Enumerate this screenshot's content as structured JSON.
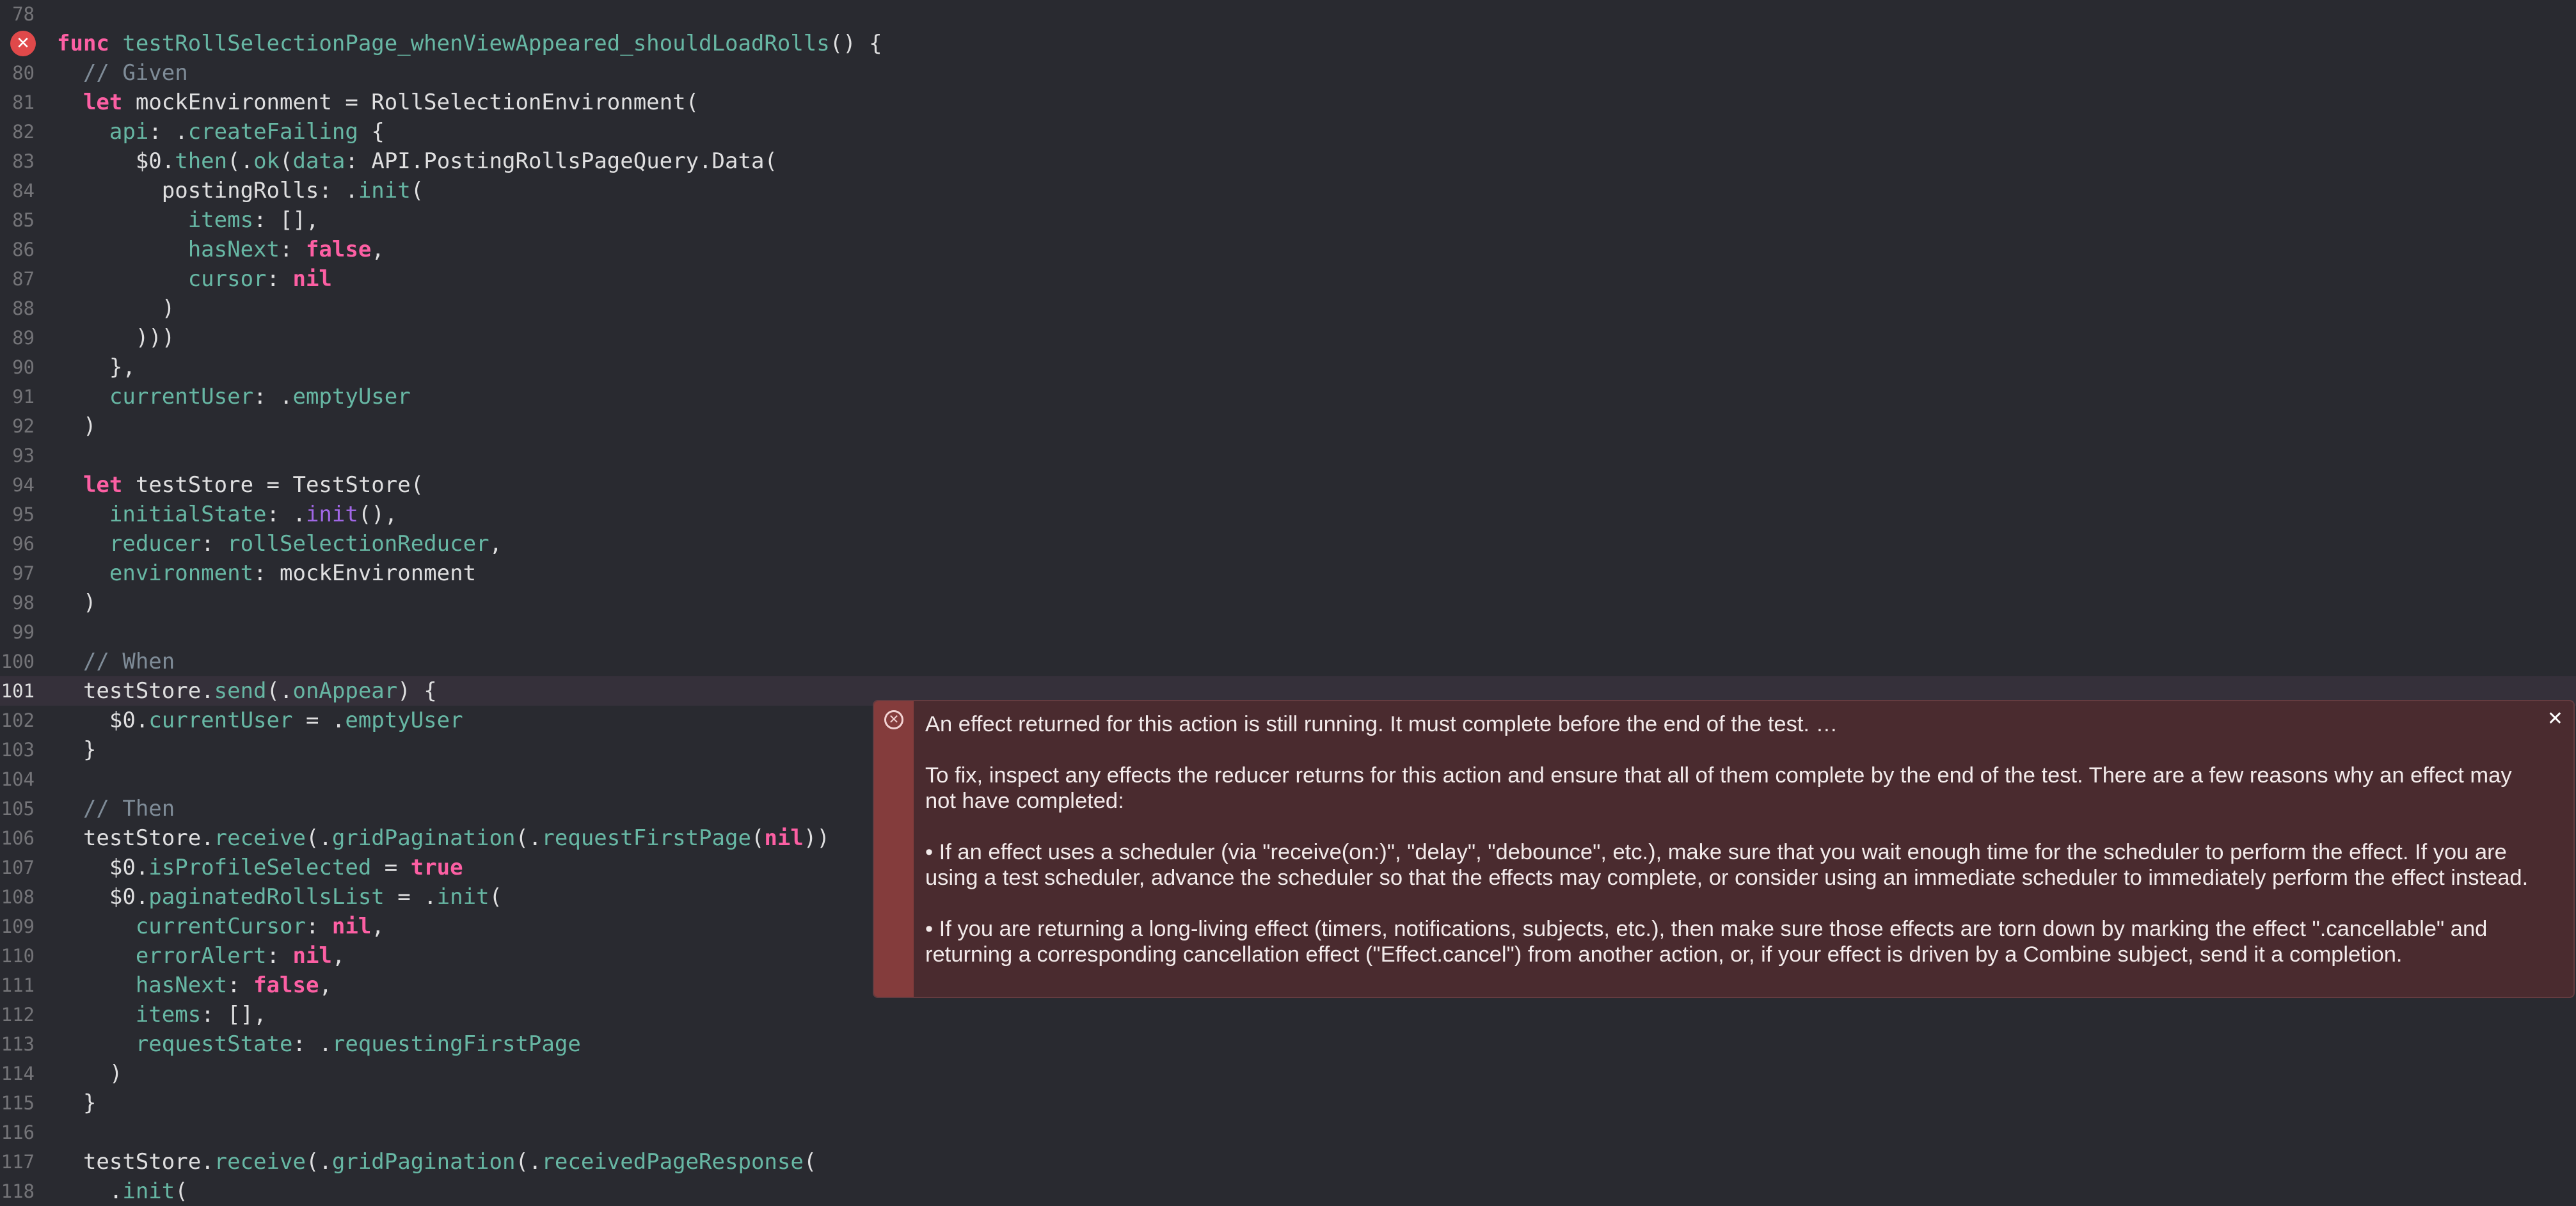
{
  "editor": {
    "lines": [
      {
        "n": "78",
        "spans": []
      },
      {
        "n": "",
        "spans": [
          {
            "t": "func",
            "c": "kw"
          },
          {
            "t": " "
          },
          {
            "t": "testRollSelectionPage_whenViewAppeared_shouldLoadRolls",
            "c": "fn"
          },
          {
            "t": "() {"
          }
        ]
      },
      {
        "n": "80",
        "spans": [
          {
            "t": "  // Given",
            "c": "cm"
          }
        ]
      },
      {
        "n": "81",
        "spans": [
          {
            "t": "  "
          },
          {
            "t": "let",
            "c": "kw"
          },
          {
            "t": " mockEnvironment = RollSelectionEnvironment("
          }
        ]
      },
      {
        "n": "82",
        "spans": [
          {
            "t": "    "
          },
          {
            "t": "api",
            "c": "fn"
          },
          {
            "t": ": ."
          },
          {
            "t": "createFailing",
            "c": "fn"
          },
          {
            "t": " {"
          }
        ]
      },
      {
        "n": "83",
        "spans": [
          {
            "t": "      $0."
          },
          {
            "t": "then",
            "c": "fn"
          },
          {
            "t": "(."
          },
          {
            "t": "ok",
            "c": "fn"
          },
          {
            "t": "("
          },
          {
            "t": "data",
            "c": "fn"
          },
          {
            "t": ": API.PostingRollsPageQuery.Data("
          }
        ]
      },
      {
        "n": "84",
        "spans": [
          {
            "t": "        postingRolls: ."
          },
          {
            "t": "init",
            "c": "fn"
          },
          {
            "t": "("
          }
        ]
      },
      {
        "n": "85",
        "spans": [
          {
            "t": "          "
          },
          {
            "t": "items",
            "c": "fn"
          },
          {
            "t": ": [],"
          }
        ]
      },
      {
        "n": "86",
        "spans": [
          {
            "t": "          "
          },
          {
            "t": "hasNext",
            "c": "fn"
          },
          {
            "t": ": "
          },
          {
            "t": "false",
            "c": "kw"
          },
          {
            "t": ","
          }
        ]
      },
      {
        "n": "87",
        "spans": [
          {
            "t": "          "
          },
          {
            "t": "cursor",
            "c": "fn"
          },
          {
            "t": ": "
          },
          {
            "t": "nil",
            "c": "kw"
          }
        ]
      },
      {
        "n": "88",
        "spans": [
          {
            "t": "        )"
          }
        ]
      },
      {
        "n": "89",
        "spans": [
          {
            "t": "      )))"
          }
        ]
      },
      {
        "n": "90",
        "spans": [
          {
            "t": "    },"
          }
        ]
      },
      {
        "n": "91",
        "spans": [
          {
            "t": "    "
          },
          {
            "t": "currentUser",
            "c": "fn"
          },
          {
            "t": ": ."
          },
          {
            "t": "emptyUser",
            "c": "fn"
          }
        ]
      },
      {
        "n": "92",
        "spans": [
          {
            "t": "  )"
          }
        ]
      },
      {
        "n": "93",
        "spans": []
      },
      {
        "n": "94",
        "spans": [
          {
            "t": "  "
          },
          {
            "t": "let",
            "c": "kw"
          },
          {
            "t": " testStore = TestStore("
          }
        ]
      },
      {
        "n": "95",
        "spans": [
          {
            "t": "    "
          },
          {
            "t": "initialState",
            "c": "fn"
          },
          {
            "t": ": ."
          },
          {
            "t": "init",
            "c": "mem"
          },
          {
            "t": "(),"
          }
        ]
      },
      {
        "n": "96",
        "spans": [
          {
            "t": "    "
          },
          {
            "t": "reducer",
            "c": "fn"
          },
          {
            "t": ": "
          },
          {
            "t": "rollSelectionReducer",
            "c": "fn"
          },
          {
            "t": ","
          }
        ]
      },
      {
        "n": "97",
        "spans": [
          {
            "t": "    "
          },
          {
            "t": "environment",
            "c": "fn"
          },
          {
            "t": ": mockEnvironment"
          }
        ]
      },
      {
        "n": "98",
        "spans": [
          {
            "t": "  )"
          }
        ]
      },
      {
        "n": "99",
        "spans": []
      },
      {
        "n": "100",
        "spans": [
          {
            "t": "  // When",
            "c": "cm"
          }
        ]
      },
      {
        "n": "101",
        "spans": [
          {
            "t": "  testStore."
          },
          {
            "t": "send",
            "c": "fn"
          },
          {
            "t": "(."
          },
          {
            "t": "onAppear",
            "c": "fn"
          },
          {
            "t": ") {"
          }
        ]
      },
      {
        "n": "102",
        "spans": [
          {
            "t": "    $0."
          },
          {
            "t": "currentUser",
            "c": "fn"
          },
          {
            "t": " = ."
          },
          {
            "t": "emptyUser",
            "c": "fn"
          }
        ]
      },
      {
        "n": "103",
        "spans": [
          {
            "t": "  }"
          }
        ]
      },
      {
        "n": "104",
        "spans": []
      },
      {
        "n": "105",
        "spans": [
          {
            "t": "  // Then",
            "c": "cm"
          }
        ]
      },
      {
        "n": "106",
        "spans": [
          {
            "t": "  testStore."
          },
          {
            "t": "receive",
            "c": "fn"
          },
          {
            "t": "(."
          },
          {
            "t": "gridPagination",
            "c": "fn"
          },
          {
            "t": "(."
          },
          {
            "t": "requestFirstPage",
            "c": "fn"
          },
          {
            "t": "("
          },
          {
            "t": "nil",
            "c": "kw"
          },
          {
            "t": "))"
          }
        ]
      },
      {
        "n": "107",
        "spans": [
          {
            "t": "    $0."
          },
          {
            "t": "isProfileSelected",
            "c": "fn"
          },
          {
            "t": " = "
          },
          {
            "t": "true",
            "c": "kw"
          }
        ]
      },
      {
        "n": "108",
        "spans": [
          {
            "t": "    $0."
          },
          {
            "t": "paginatedRollsList",
            "c": "fn"
          },
          {
            "t": " = ."
          },
          {
            "t": "init",
            "c": "fn"
          },
          {
            "t": "("
          }
        ]
      },
      {
        "n": "109",
        "spans": [
          {
            "t": "      "
          },
          {
            "t": "currentCursor",
            "c": "fn"
          },
          {
            "t": ": "
          },
          {
            "t": "nil",
            "c": "kw"
          },
          {
            "t": ","
          }
        ]
      },
      {
        "n": "110",
        "spans": [
          {
            "t": "      "
          },
          {
            "t": "errorAlert",
            "c": "fn"
          },
          {
            "t": ": "
          },
          {
            "t": "nil",
            "c": "kw"
          },
          {
            "t": ","
          }
        ]
      },
      {
        "n": "111",
        "spans": [
          {
            "t": "      "
          },
          {
            "t": "hasNext",
            "c": "fn"
          },
          {
            "t": ": "
          },
          {
            "t": "false",
            "c": "kw"
          },
          {
            "t": ","
          }
        ]
      },
      {
        "n": "112",
        "spans": [
          {
            "t": "      "
          },
          {
            "t": "items",
            "c": "fn"
          },
          {
            "t": ": [],"
          }
        ]
      },
      {
        "n": "113",
        "spans": [
          {
            "t": "      "
          },
          {
            "t": "requestState",
            "c": "fn"
          },
          {
            "t": ": ."
          },
          {
            "t": "requestingFirstPage",
            "c": "fn"
          }
        ]
      },
      {
        "n": "114",
        "spans": [
          {
            "t": "    )"
          }
        ]
      },
      {
        "n": "115",
        "spans": [
          {
            "t": "  }"
          }
        ]
      },
      {
        "n": "116",
        "spans": []
      },
      {
        "n": "117",
        "spans": [
          {
            "t": "  testStore."
          },
          {
            "t": "receive",
            "c": "fn"
          },
          {
            "t": "(."
          },
          {
            "t": "gridPagination",
            "c": "fn"
          },
          {
            "t": "(."
          },
          {
            "t": "receivedPageResponse",
            "c": "fn"
          },
          {
            "t": "("
          }
        ]
      },
      {
        "n": "118",
        "spans": [
          {
            "t": "    ."
          },
          {
            "t": "init",
            "c": "fn"
          },
          {
            "t": "("
          }
        ]
      }
    ]
  },
  "gutter": {
    "error_icon": "error-x-icon",
    "error_glyph": "✕"
  },
  "error_popup": {
    "icon": "error-diamond-icon",
    "icon_glyph": "✕",
    "close_label": "✕",
    "paragraphs": [
      "An effect returned for this action is still running. It must complete before the end of the test. …",
      "To fix, inspect any effects the reducer returns for this action and ensure that all of them complete by the end of the test. There are a few reasons why an effect may not have completed:",
      "• If an effect uses a scheduler (via \"receive(on:)\", \"delay\", \"debounce\", etc.), make sure that you wait enough time for the scheduler to perform the effect. If you are using a test scheduler, advance the scheduler so that the effects may complete, or consider using an immediate scheduler to immediately perform the effect instead.",
      "• If you are returning a long-living effect (timers, notifications, subjects, etc.), then make sure those effects are torn down by marking the effect \".cancellable\" and returning a corresponding cancellation effect (\"Effect.cancel\") from another action, or, if your effect is driven by a Combine subject, send it a completion."
    ]
  },
  "colors": {
    "background": "#292a30",
    "keyword": "#fc5fa3",
    "identifier": "#67b7a4",
    "comment": "#7f8c98",
    "member": "#a167e6",
    "error_bg": "#4a2b2f",
    "error_strip": "#843c3c"
  }
}
